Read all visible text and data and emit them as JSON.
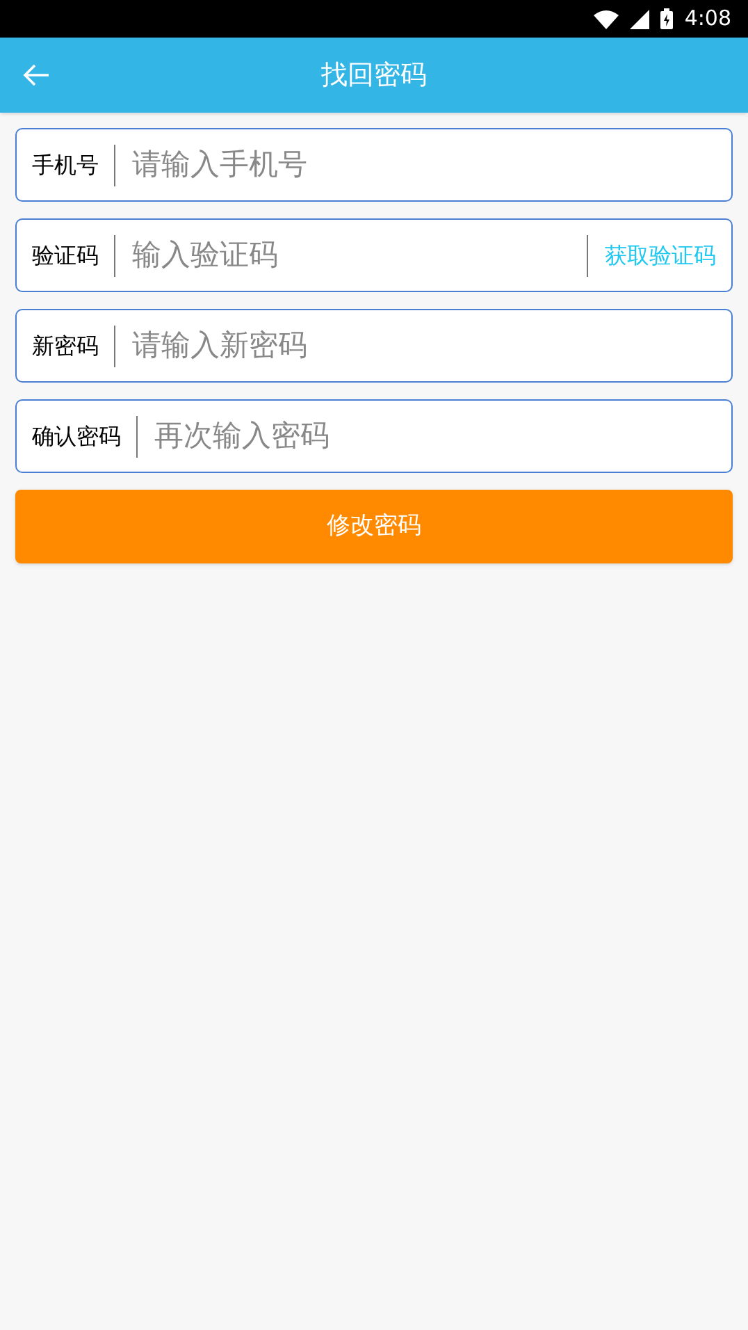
{
  "status_bar": {
    "time": "4:08"
  },
  "app_bar": {
    "title": "找回密码"
  },
  "fields": [
    {
      "label": "手机号",
      "placeholder": "请输入手机号"
    },
    {
      "label": "验证码",
      "placeholder": "输入验证码",
      "action": "获取验证码"
    },
    {
      "label": "新密码",
      "placeholder": "请输入新密码"
    },
    {
      "label": "确认密码",
      "placeholder": "再次输入密码"
    }
  ],
  "submit_button": "修改密码"
}
